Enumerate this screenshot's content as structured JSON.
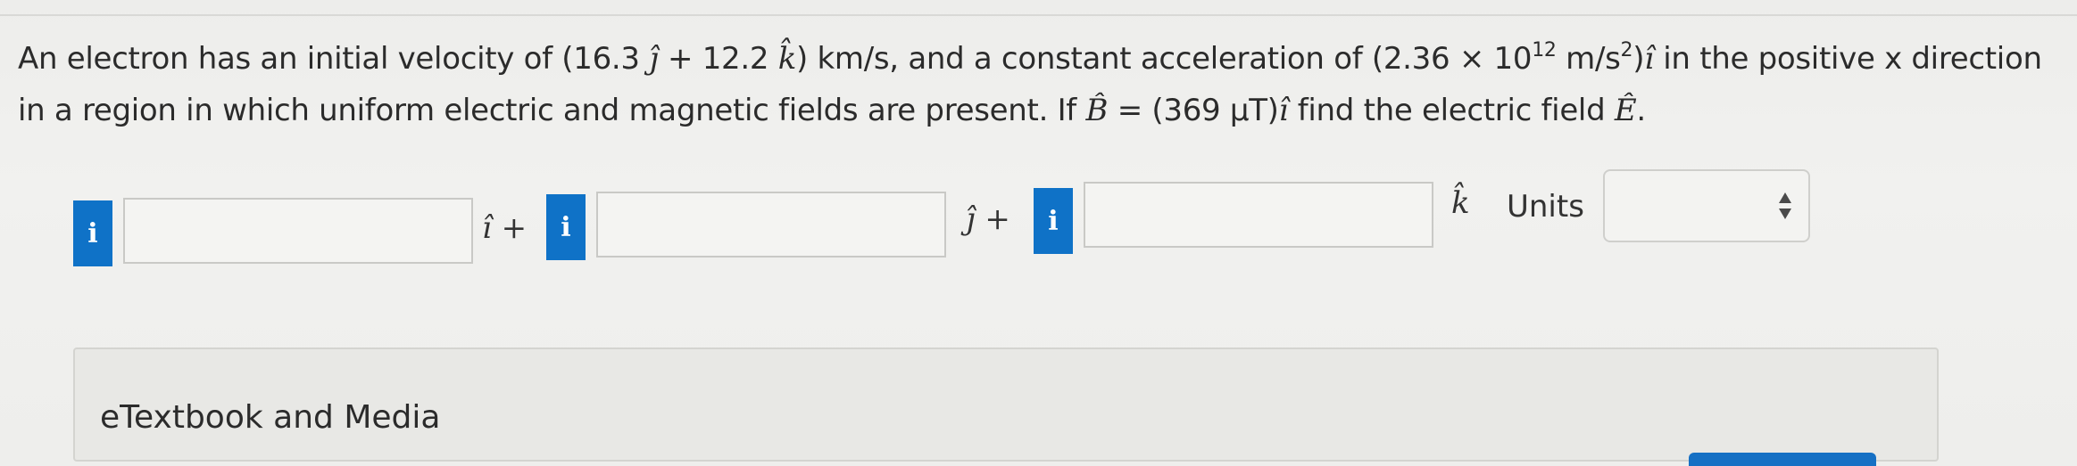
{
  "question": {
    "line1": [
      {
        "t": "An electron has an initial velocity of (16.3 "
      },
      {
        "m": "ĵ"
      },
      {
        "t": " + 12.2 "
      },
      {
        "m": "k̂"
      },
      {
        "t": ") km/s, and a constant acceleration of (2.36 × 10"
      },
      {
        "sup": "12"
      },
      {
        "t": " m/s"
      },
      {
        "sup": "2"
      },
      {
        "t": ")"
      },
      {
        "m": "î"
      },
      {
        "t": " in the positive x direction"
      }
    ],
    "line2": [
      {
        "t": "in a region in which uniform electric and magnetic fields are present. If "
      },
      {
        "m": "B̂"
      },
      {
        "t": " = (369 μT)"
      },
      {
        "m": "î"
      },
      {
        "t": " find the electric field "
      },
      {
        "m": "Ê"
      },
      {
        "t": "."
      }
    ]
  },
  "answer": {
    "info_symbol": "i",
    "component_i": {
      "value": "",
      "suffix": "î +"
    },
    "component_j": {
      "value": "",
      "suffix": "ĵ +"
    },
    "component_k": {
      "value": "",
      "suffix": "k̂"
    },
    "units_label": "Units",
    "units_value": ""
  },
  "etextbook_label": "eTextbook and Media",
  "colors": {
    "info_blue": "#0f72c7",
    "background": "#efefed"
  },
  "icons": [
    "info-icon",
    "info-icon",
    "info-icon",
    "select-arrows-icon"
  ]
}
